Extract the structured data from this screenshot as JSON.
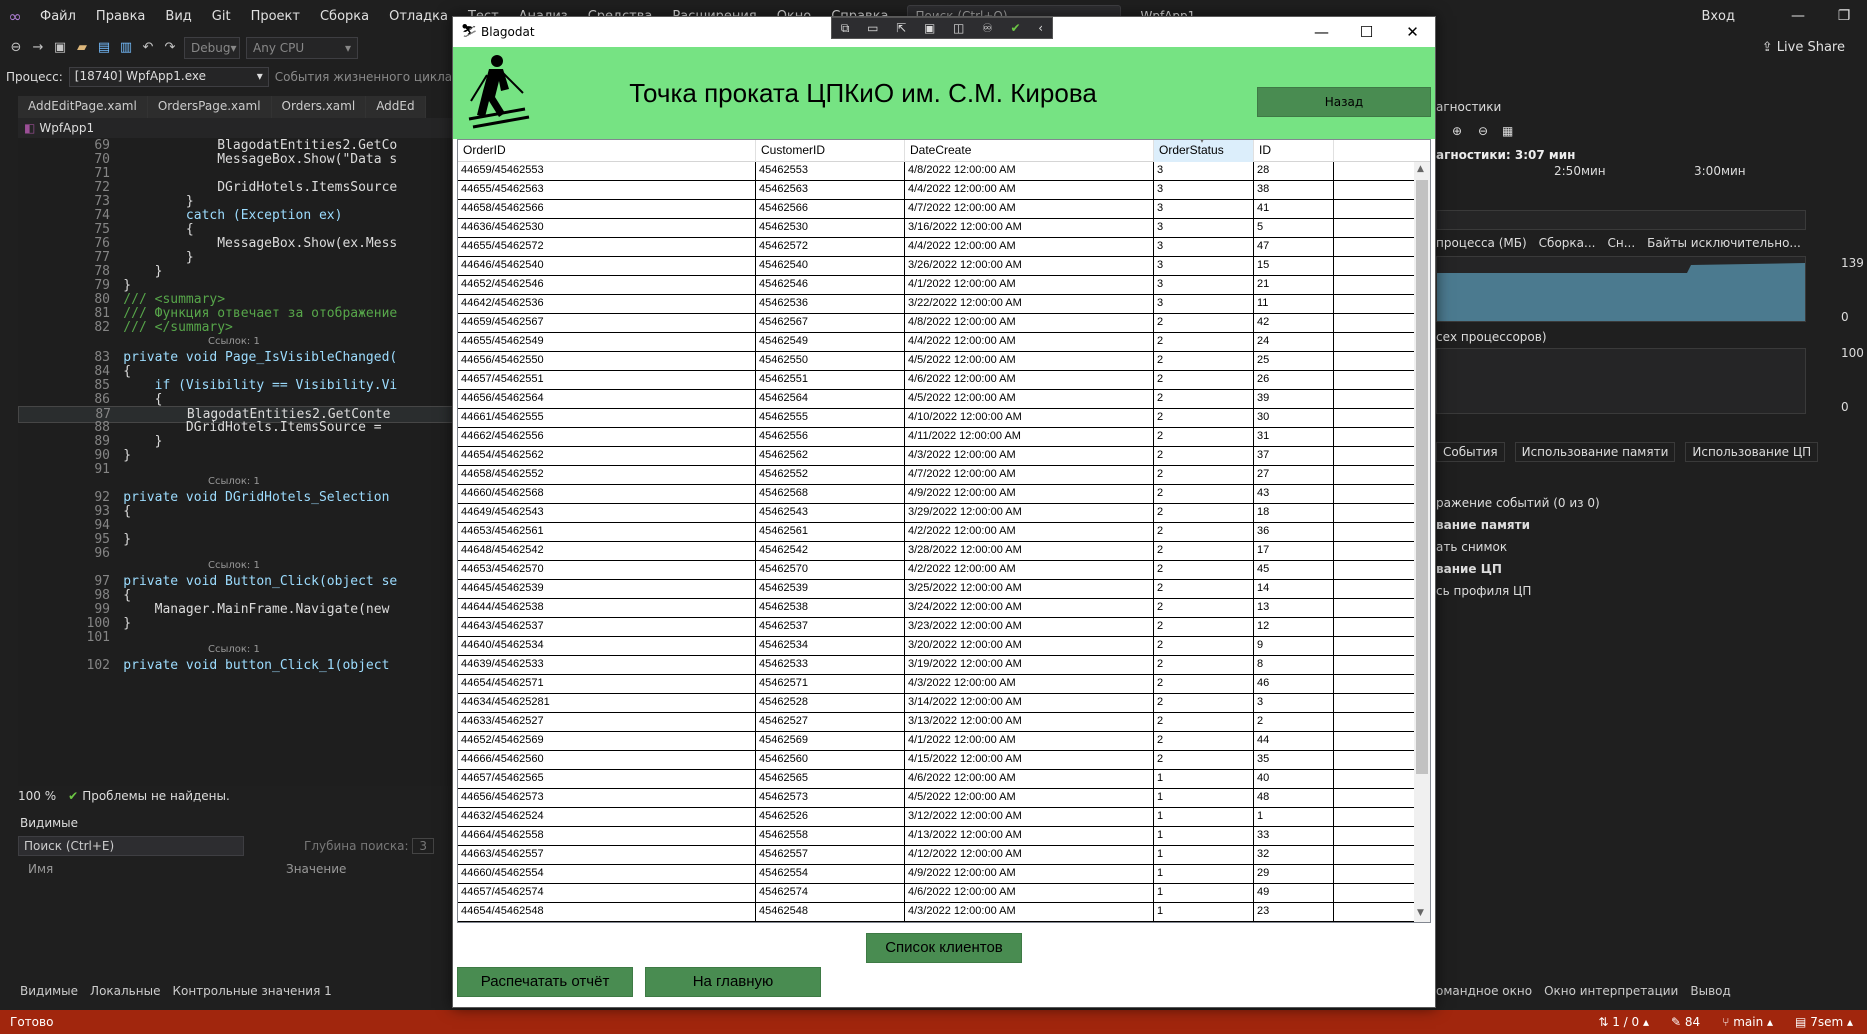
{
  "vs": {
    "menu": [
      "Файл",
      "Правка",
      "Вид",
      "Git",
      "Проект",
      "Сборка",
      "Отладка",
      "Тест",
      "Анализ",
      "Средства",
      "Расширения",
      "Окно",
      "Справка"
    ],
    "search_placeholder": "Поиск (Ctrl+Q)",
    "solution_name": "WpfApp1",
    "sign_in": "Вход",
    "live_share": "Live Share",
    "config_combo": "Debug",
    "platform_combo": "Any CPU",
    "process_label": "Процесс:",
    "process_value": "[18740] WpfApp1.exe",
    "lifecycle_label": "События жизненного цикла",
    "doc_tabs": [
      "AddEditPage.xaml",
      "OrdersPage.xaml",
      "Orders.xaml",
      "AddEd"
    ],
    "nav_project": "WpfApp1",
    "zoom": "100 %",
    "problems": "Проблемы не найдены.",
    "watch": {
      "title": "Видимые",
      "search": "Поиск (Ctrl+E)",
      "depth_label": "Глубина поиска:",
      "depth_value": "3",
      "col_name": "Имя",
      "col_value": "Значение",
      "tabs": [
        "Видимые",
        "Локальные",
        "Контрольные значения 1"
      ]
    },
    "diagnostics": {
      "title": "агностики",
      "session_time": "агностики: 3:07 мин",
      "time_1": "2:50мин",
      "time_2": "3:00мин",
      "memory_legend": [
        "процесса (МБ)",
        "Сборка...",
        "Сн...",
        "Байты исключительно..."
      ],
      "memory_max": "139",
      "memory_min": "0",
      "cpu_legend": "сех процессоров)",
      "cpu_max": "100",
      "cpu_min": "0",
      "tabs": [
        "События",
        "Использование памяти",
        "Использование ЦП"
      ],
      "items": [
        "ражение событий (0 из 0)",
        "вание памяти",
        "ать снимок",
        "вание ЦП",
        "сь профиля ЦП"
      ]
    },
    "bottom_right_tabs": [
      "омандное окно",
      "Окно интерпретации",
      "Вывод"
    ],
    "status": {
      "ready": "Готово",
      "line_info": "1 / 0",
      "changes": "84",
      "branch": "main",
      "repo": "7sem"
    },
    "code_lines": [
      {
        "n": "69",
        "t": "                BlagodatEntities2.GetCo"
      },
      {
        "n": "70",
        "t": "                MessageBox.Show(\"Data s"
      },
      {
        "n": "71",
        "t": ""
      },
      {
        "n": "72",
        "t": "                DGridHotels.ItemsSource"
      },
      {
        "n": "73",
        "t": "            }"
      },
      {
        "n": "74",
        "t": "            catch (Exception ex)"
      },
      {
        "n": "75",
        "t": "            {"
      },
      {
        "n": "76",
        "t": "                MessageBox.Show(ex.Mess"
      },
      {
        "n": "77",
        "t": "            }"
      },
      {
        "n": "78",
        "t": "        }"
      },
      {
        "n": "79",
        "t": "    }"
      },
      {
        "n": "80",
        "t": "    /// <summary>"
      },
      {
        "n": "81",
        "t": "    /// Функция отвечает за отображение"
      },
      {
        "n": "82",
        "t": "    /// </summary>"
      },
      {
        "n": "83",
        "t": "    private void Page_IsVisibleChanged("
      },
      {
        "n": "84",
        "t": "    {"
      },
      {
        "n": "85",
        "t": "        if (Visibility == Visibility.Vi"
      },
      {
        "n": "86",
        "t": "        {"
      },
      {
        "n": "87",
        "t": "            BlagodatEntities2.GetConte"
      },
      {
        "n": "88",
        "t": "            DGridHotels.ItemsSource = "
      },
      {
        "n": "89",
        "t": "        }"
      },
      {
        "n": "90",
        "t": "    }"
      },
      {
        "n": "91",
        "t": ""
      },
      {
        "n": "92",
        "t": "    private void DGridHotels_Selection"
      },
      {
        "n": "93",
        "t": "    {"
      },
      {
        "n": "94",
        "t": ""
      },
      {
        "n": "95",
        "t": "    }"
      },
      {
        "n": "96",
        "t": ""
      },
      {
        "n": "97",
        "t": "    private void Button_Click(object se"
      },
      {
        "n": "98",
        "t": "    {"
      },
      {
        "n": "99",
        "t": "        Manager.MainFrame.Navigate(new "
      },
      {
        "n": "100",
        "t": "    }"
      },
      {
        "n": "101",
        "t": ""
      },
      {
        "n": "102",
        "t": "    private void button_Click_1(object "
      }
    ],
    "ref_hint": "Ссылок: 1"
  },
  "wpf": {
    "title": "Blagodat",
    "heading": "Точка проката ЦПКиО им. С.М. Кирова",
    "back_label": "Назад",
    "columns": [
      "OrderID",
      "CustomerID",
      "DateCreate",
      "OrderStatus",
      "ID"
    ],
    "rows": [
      [
        "44659/45462553",
        "45462553",
        "4/8/2022 12:00:00 AM",
        "3",
        "28"
      ],
      [
        "44655/45462563",
        "45462563",
        "4/4/2022 12:00:00 AM",
        "3",
        "38"
      ],
      [
        "44658/45462566",
        "45462566",
        "4/7/2022 12:00:00 AM",
        "3",
        "41"
      ],
      [
        "44636/45462530",
        "45462530",
        "3/16/2022 12:00:00 AM",
        "3",
        "5"
      ],
      [
        "44655/45462572",
        "45462572",
        "4/4/2022 12:00:00 AM",
        "3",
        "47"
      ],
      [
        "44646/45462540",
        "45462540",
        "3/26/2022 12:00:00 AM",
        "3",
        "15"
      ],
      [
        "44652/45462546",
        "45462546",
        "4/1/2022 12:00:00 AM",
        "3",
        "21"
      ],
      [
        "44642/45462536",
        "45462536",
        "3/22/2022 12:00:00 AM",
        "3",
        "11"
      ],
      [
        "44659/45462567",
        "45462567",
        "4/8/2022 12:00:00 AM",
        "2",
        "42"
      ],
      [
        "44655/45462549",
        "45462549",
        "4/4/2022 12:00:00 AM",
        "2",
        "24"
      ],
      [
        "44656/45462550",
        "45462550",
        "4/5/2022 12:00:00 AM",
        "2",
        "25"
      ],
      [
        "44657/45462551",
        "45462551",
        "4/6/2022 12:00:00 AM",
        "2",
        "26"
      ],
      [
        "44656/45462564",
        "45462564",
        "4/5/2022 12:00:00 AM",
        "2",
        "39"
      ],
      [
        "44661/45462555",
        "45462555",
        "4/10/2022 12:00:00 AM",
        "2",
        "30"
      ],
      [
        "44662/45462556",
        "45462556",
        "4/11/2022 12:00:00 AM",
        "2",
        "31"
      ],
      [
        "44654/45462562",
        "45462562",
        "4/3/2022 12:00:00 AM",
        "2",
        "37"
      ],
      [
        "44658/45462552",
        "45462552",
        "4/7/2022 12:00:00 AM",
        "2",
        "27"
      ],
      [
        "44660/45462568",
        "45462568",
        "4/9/2022 12:00:00 AM",
        "2",
        "43"
      ],
      [
        "44649/45462543",
        "45462543",
        "3/29/2022 12:00:00 AM",
        "2",
        "18"
      ],
      [
        "44653/45462561",
        "45462561",
        "4/2/2022 12:00:00 AM",
        "2",
        "36"
      ],
      [
        "44648/45462542",
        "45462542",
        "3/28/2022 12:00:00 AM",
        "2",
        "17"
      ],
      [
        "44653/45462570",
        "45462570",
        "4/2/2022 12:00:00 AM",
        "2",
        "45"
      ],
      [
        "44645/45462539",
        "45462539",
        "3/25/2022 12:00:00 AM",
        "2",
        "14"
      ],
      [
        "44644/45462538",
        "45462538",
        "3/24/2022 12:00:00 AM",
        "2",
        "13"
      ],
      [
        "44643/45462537",
        "45462537",
        "3/23/2022 12:00:00 AM",
        "2",
        "12"
      ],
      [
        "44640/45462534",
        "45462534",
        "3/20/2022 12:00:00 AM",
        "2",
        "9"
      ],
      [
        "44639/45462533",
        "45462533",
        "3/19/2022 12:00:00 AM",
        "2",
        "8"
      ],
      [
        "44654/45462571",
        "45462571",
        "4/3/2022 12:00:00 AM",
        "2",
        "46"
      ],
      [
        "44634/454625281",
        "45462528",
        "3/14/2022 12:00:00 AM",
        "2",
        "3"
      ],
      [
        "44633/45462527",
        "45462527",
        "3/13/2022 12:00:00 AM",
        "2",
        "2"
      ],
      [
        "44652/45462569",
        "45462569",
        "4/1/2022 12:00:00 AM",
        "2",
        "44"
      ],
      [
        "44666/45462560",
        "45462560",
        "4/15/2022 12:00:00 AM",
        "2",
        "35"
      ],
      [
        "44657/45462565",
        "45462565",
        "4/6/2022 12:00:00 AM",
        "1",
        "40"
      ],
      [
        "44656/45462573",
        "45462573",
        "4/5/2022 12:00:00 AM",
        "1",
        "48"
      ],
      [
        "44632/45462524",
        "45462526",
        "3/12/2022 12:00:00 AM",
        "1",
        "1"
      ],
      [
        "44664/45462558",
        "45462558",
        "4/13/2022 12:00:00 AM",
        "1",
        "33"
      ],
      [
        "44663/45462557",
        "45462557",
        "4/12/2022 12:00:00 AM",
        "1",
        "32"
      ],
      [
        "44660/45462554",
        "45462554",
        "4/9/2022 12:00:00 AM",
        "1",
        "29"
      ],
      [
        "44657/45462574",
        "45462574",
        "4/6/2022 12:00:00 AM",
        "1",
        "49"
      ],
      [
        "44654/45462548",
        "45462548",
        "4/3/2022 12:00:00 AM",
        "1",
        "23"
      ]
    ],
    "clients_label": "Список клиентов",
    "print_label": "Распечатать отчёт",
    "home_label": "На главную"
  },
  "colors": {
    "header_green": "#76e383",
    "button_green": "#498c51",
    "status_red": "#a1260d"
  }
}
